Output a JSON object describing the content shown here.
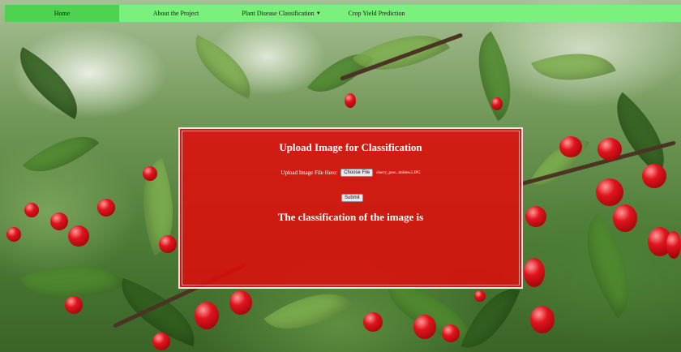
{
  "navbar": {
    "items": [
      {
        "label": "Home"
      },
      {
        "label": "About the Project"
      },
      {
        "label": "Plant Disease Classification",
        "caret": "▼"
      },
      {
        "label": "Crop Yield Prediction"
      }
    ]
  },
  "upload_panel": {
    "title": "Upload Image for Classification",
    "file_label": "Upload Image File Here:",
    "choose_button": "Choose File",
    "file_name": "cherry_pow...mildew2.JPG",
    "submit_button": "Submit",
    "result_text": "The classification of the image is"
  },
  "colors": {
    "navbar_bg": "#7cf07c",
    "navbar_active": "#4fd24f",
    "panel_bg": "#e10a0a"
  }
}
